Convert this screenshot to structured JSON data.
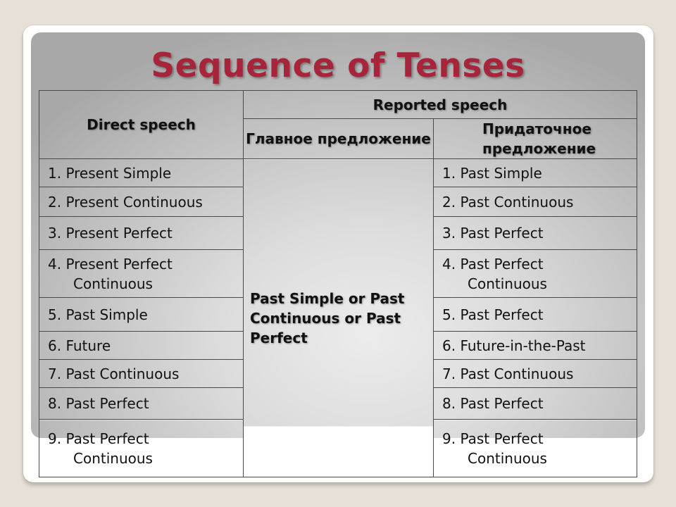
{
  "slide": {
    "title": "Sequence of Tenses",
    "title_color": "#a8243a"
  },
  "table": {
    "headers": {
      "direct_speech": "Direct speech",
      "reported_speech": "Reported speech",
      "main_clause": "Главное предложение",
      "subordinate_clause": "Придаточное предложение"
    },
    "main_clause_value": "Past Simple or Past Continuous or Past Perfect",
    "rows": [
      {
        "direct": "1.  Present Simple",
        "direct_cont": "",
        "reported": "1. Past Simple",
        "reported_cont": ""
      },
      {
        "direct": "2. Present Continuous",
        "direct_cont": "",
        "reported": "2. Past Continuous",
        "reported_cont": ""
      },
      {
        "direct": "3. Present Perfect",
        "direct_cont": "",
        "reported": "3. Past Perfect",
        "reported_cont": ""
      },
      {
        "direct": "4. Present Perfect",
        "direct_cont": "Continuous",
        "reported": "4. Past Perfect",
        "reported_cont": "Continuous"
      },
      {
        "direct": "5. Past Simple",
        "direct_cont": "",
        "reported": "5. Past Perfect",
        "reported_cont": ""
      },
      {
        "direct": "6. Future",
        "direct_cont": "",
        "reported": "6. Future-in-the-Past",
        "reported_cont": ""
      },
      {
        "direct": "7. Past Continuous",
        "direct_cont": "",
        "reported": "7. Past Continuous",
        "reported_cont": ""
      },
      {
        "direct": "8. Past Perfect",
        "direct_cont": "",
        "reported": "8. Past Perfect",
        "reported_cont": ""
      },
      {
        "direct": "9. Past Perfect",
        "direct_cont": "Continuous",
        "reported": "9. Past Perfect",
        "reported_cont": "Continuous"
      }
    ]
  }
}
